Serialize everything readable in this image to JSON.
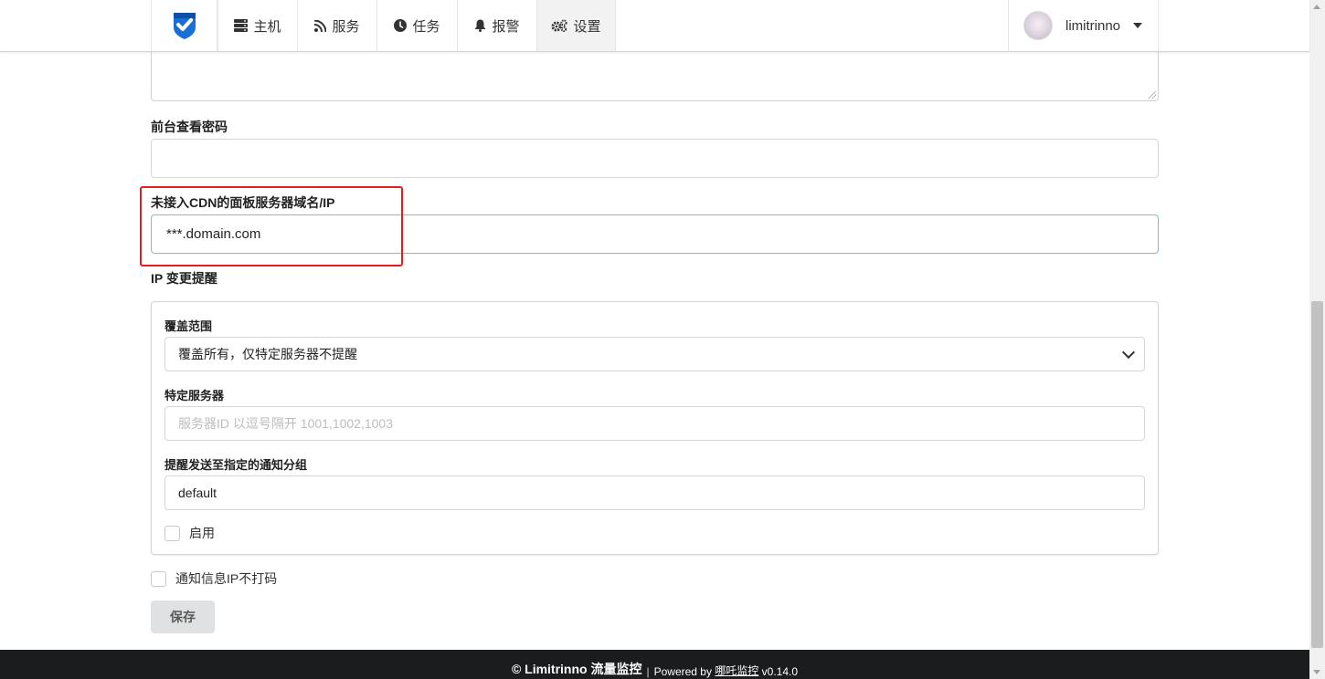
{
  "nav": {
    "items": [
      {
        "label": "主机",
        "icon": "server-icon"
      },
      {
        "label": "服务",
        "icon": "rss-icon"
      },
      {
        "label": "任务",
        "icon": "clock-icon"
      },
      {
        "label": "报警",
        "icon": "bell-icon"
      },
      {
        "label": "设置",
        "icon": "gears-icon"
      }
    ],
    "active": "设置",
    "username": "limitrinno",
    "brand_color": "#1f6feb"
  },
  "form": {
    "view_password_label": "前台查看密码",
    "view_password_value": "",
    "domain_label": "未接入CDN的面板服务器域名/IP",
    "domain_value": "***.domain.com",
    "ip_change_label": "IP 变更提醒",
    "ip_change": {
      "scope_label": "覆盖范围",
      "scope_value": "覆盖所有，仅特定服务器不提醒",
      "servers_label": "特定服务器",
      "servers_placeholder": "服务器ID 以逗号隔开 1001,1002,1003",
      "notify_group_label": "提醒发送至指定的通知分组",
      "notify_group_value": "default",
      "enable_label": "启用"
    },
    "no_mask_label": "通知信息IP不打码",
    "save_label": "保存"
  },
  "footer": {
    "copyright": "© Limitrinno 流量监控",
    "powered_prefix": "Powered by",
    "powered_name": "哪吒监控",
    "version": "v0.14.0"
  },
  "colors": {
    "highlight": "#e02020",
    "focus_border": "#85b7d9",
    "footer_bg": "#1b1c1d"
  }
}
